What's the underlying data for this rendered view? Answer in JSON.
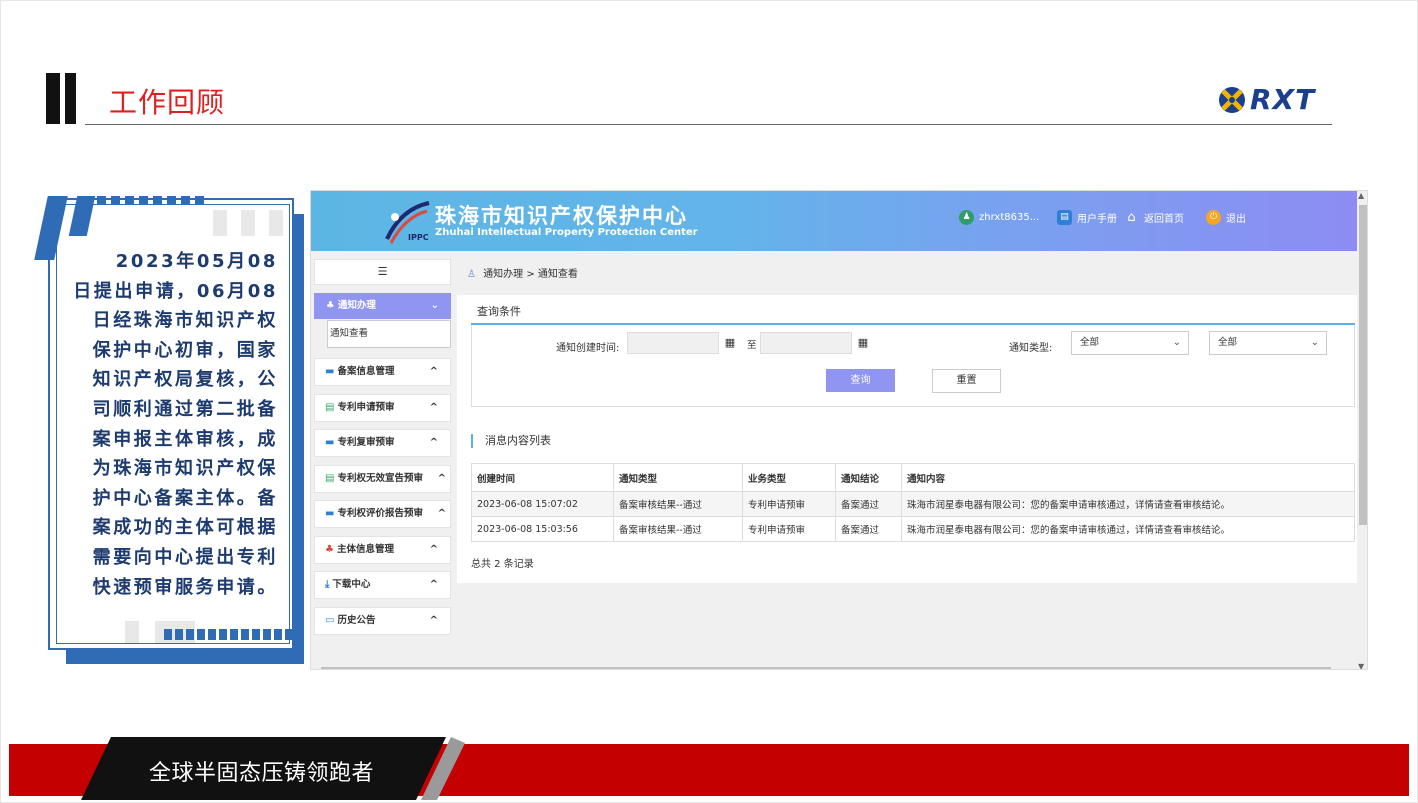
{
  "slide": {
    "title": "工作回顾",
    "logo_text": "RXT",
    "footer_text": "全球半固态压铸领跑者",
    "accent_red": "#e02020",
    "accent_blue": "#2f6cb5",
    "footer_red": "#c40000"
  },
  "card": {
    "lines": [
      "2023年05月08",
      "日提出申请，06月08",
      "日经珠海市知识产权",
      "保护中心初审，国家",
      "知识产权局复核，公",
      "司顺利通过第二批备",
      "案申报主体审核，成",
      "为珠海市知识产权保",
      "护中心备案主体。备",
      "案成功的主体可根据",
      "需要向中心提出专利",
      "快速预审服务申请。"
    ]
  },
  "app": {
    "logo_abbr": "IPPC",
    "title_cn": "珠海市知识产权保护中心",
    "title_en": "Zhuhai Intellectual Property Protection Center",
    "header": {
      "username": "zhrxt8635...",
      "manual": "用户手册",
      "home": "返回首页",
      "logout": "退出"
    },
    "sidebar": {
      "toggle_icon": "list-icon",
      "active": {
        "label": "通知办理",
        "icon": "bell-icon"
      },
      "active_sub": "通知查看",
      "items": [
        {
          "label": "备案信息管理",
          "icon": "folder-icon"
        },
        {
          "label": "专利申请预审",
          "icon": "document-icon"
        },
        {
          "label": "专利复审预审",
          "icon": "folder-icon"
        },
        {
          "label": "专利权无效宣告预审",
          "icon": "document-icon"
        },
        {
          "label": "专利权评价报告预审",
          "icon": "folder-icon"
        },
        {
          "label": "主体信息管理",
          "icon": "org-icon"
        },
        {
          "label": "下载中心",
          "icon": "download-icon"
        },
        {
          "label": "历史公告",
          "icon": "inbox-icon"
        }
      ]
    },
    "breadcrumb": {
      "parent": "通知办理",
      "sep": ">",
      "current": "通知查看"
    },
    "query": {
      "heading": "查询条件",
      "created_label": "通知创建时间:",
      "to_label": "至",
      "type_label": "通知类型:",
      "type_value_1": "全部",
      "type_value_2": "全部",
      "query_btn": "查询",
      "reset_btn": "重置"
    },
    "list": {
      "title": "消息内容列表",
      "columns": [
        "创建时间",
        "通知类型",
        "业务类型",
        "通知结论",
        "通知内容"
      ],
      "rows": [
        [
          "2023-06-08 15:07:02",
          "备案审核结果--通过",
          "专利申请预审",
          "备案通过",
          "珠海市润星泰电器有限公司：您的备案申请审核通过，详情请查看审核结论。"
        ],
        [
          "2023-06-08 15:03:56",
          "备案审核结果--通过",
          "专利申请预审",
          "备案通过",
          "珠海市润星泰电器有限公司：您的备案申请审核通过，详情请查看审核结论。"
        ]
      ],
      "total": "总共 2 条记录"
    }
  }
}
